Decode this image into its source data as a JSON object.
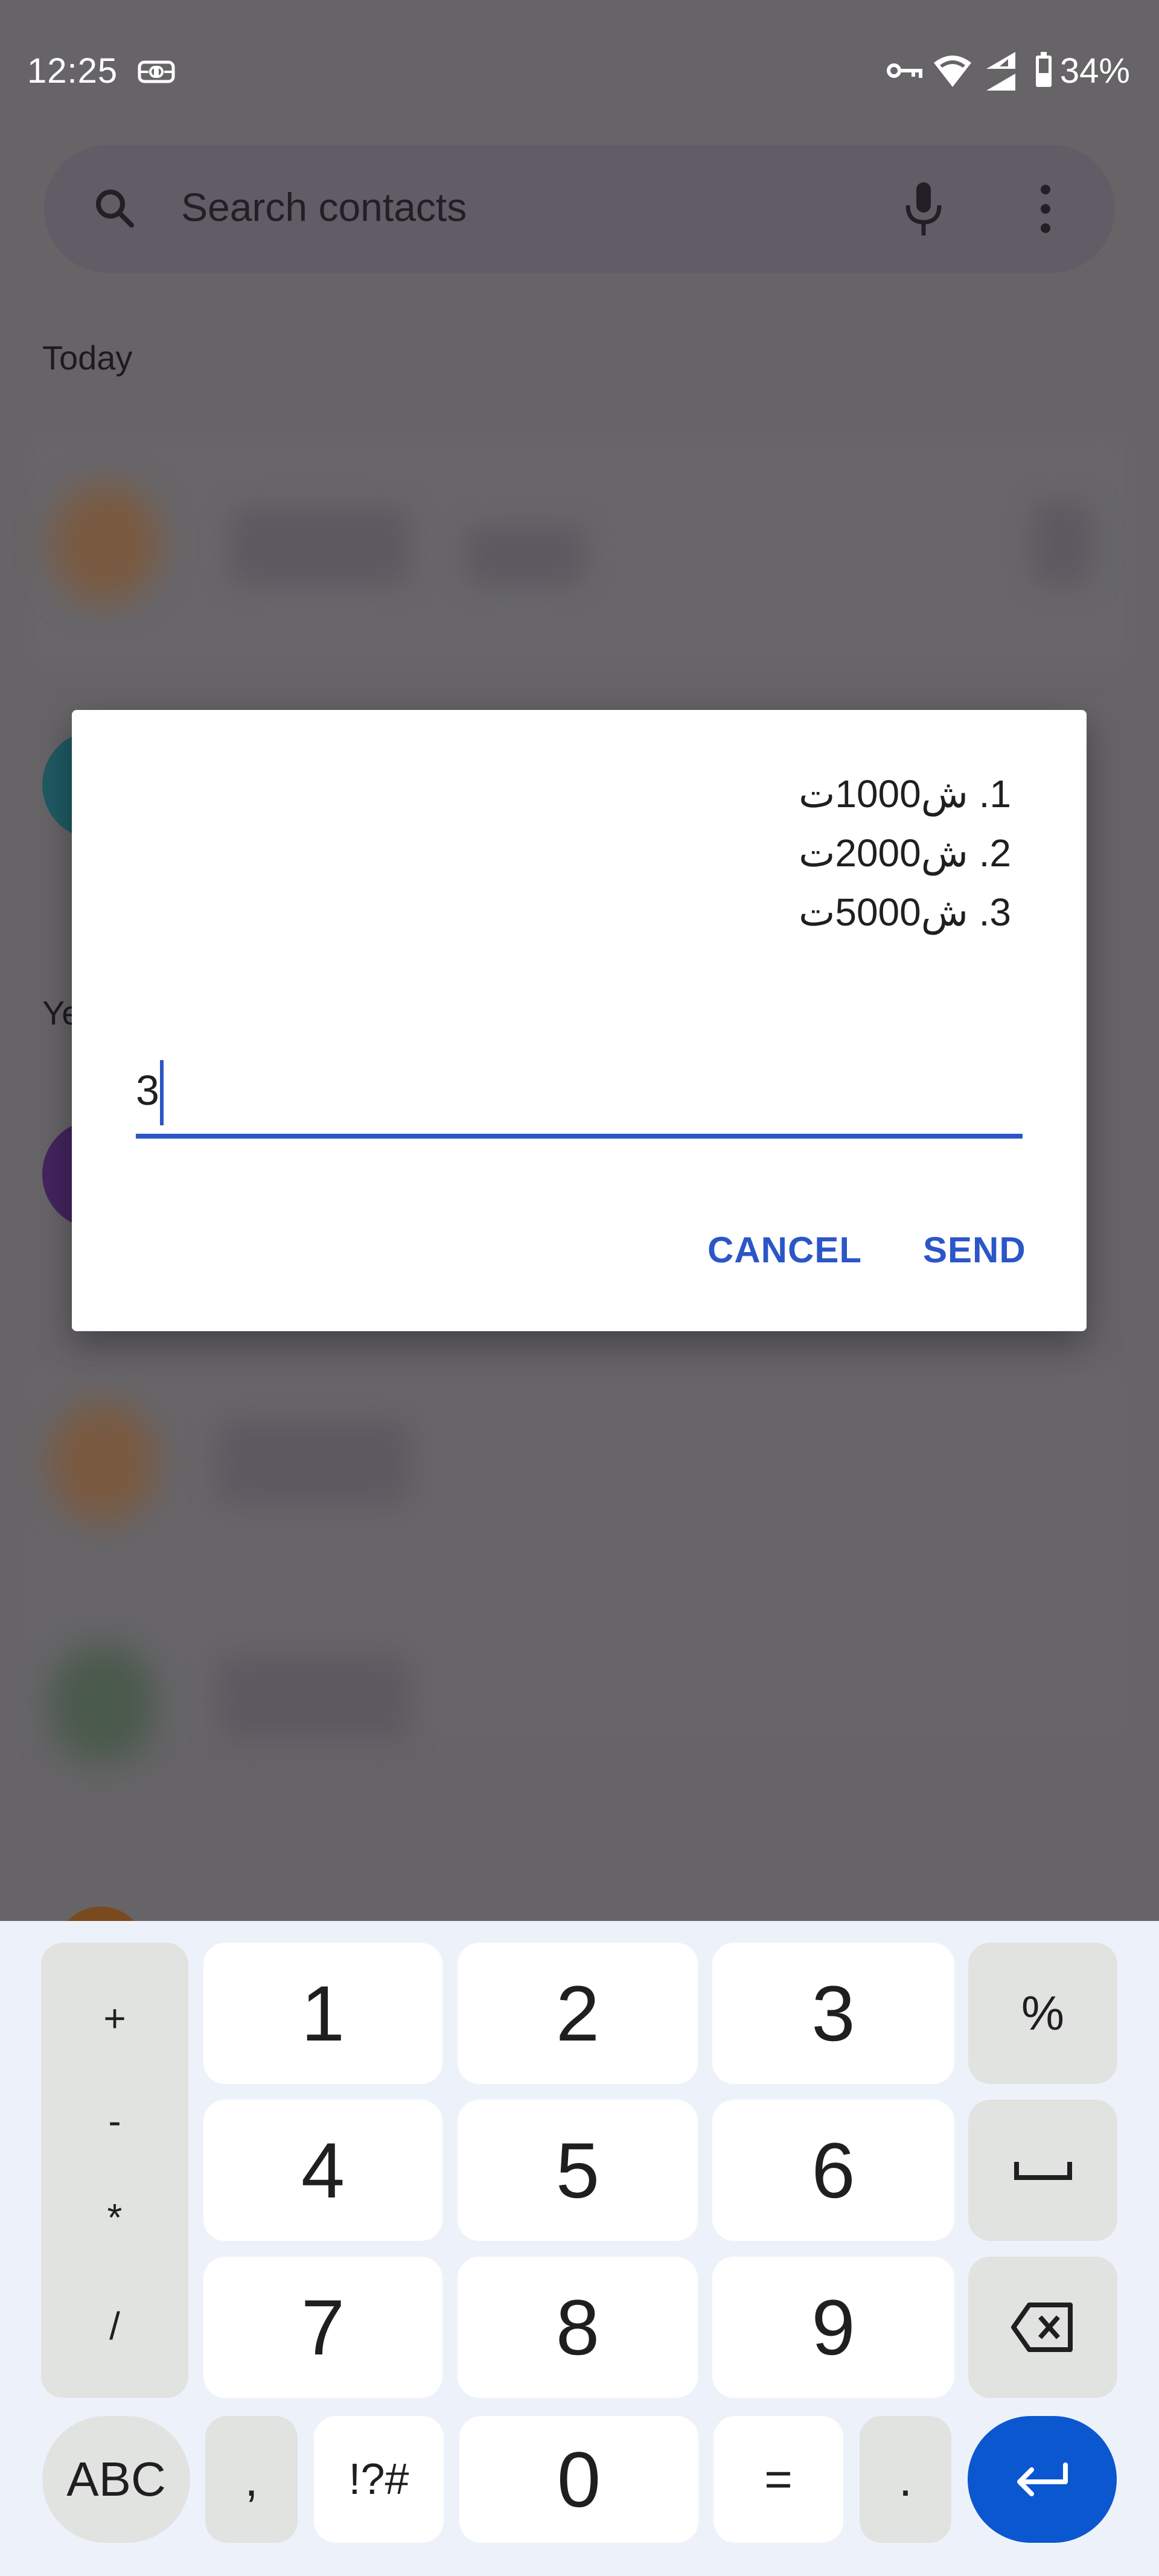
{
  "status_bar": {
    "time": "12:25",
    "left_icons": [
      "vpn-link-icon"
    ],
    "right_icons": [
      "vpn-key-icon",
      "wifi-icon",
      "cell-signal-icon",
      "battery-icon"
    ],
    "battery_percent": "34%"
  },
  "search": {
    "placeholder": "Search contacts",
    "icons": [
      "search-icon",
      "mic-icon",
      "more-vert-icon"
    ]
  },
  "sections": {
    "today": "Today",
    "yesterday_partial": "Ye"
  },
  "dialog": {
    "message_lines": [
      "1. ش1000ت",
      "2. ش2000ت",
      "3. ش5000ت"
    ],
    "input_value": "3",
    "cancel_label": "CANCEL",
    "send_label": "SEND",
    "accent_color": "#2b56c8"
  },
  "keyboard": {
    "left_symbols": [
      "+",
      "-",
      "*",
      "/"
    ],
    "rows": [
      [
        "1",
        "2",
        "3",
        "%"
      ],
      [
        "4",
        "5",
        "6",
        "space"
      ],
      [
        "7",
        "8",
        "9",
        "backspace"
      ]
    ],
    "bottom_row": [
      "ABC",
      ",",
      "!?#",
      "0",
      "=",
      ".",
      "enter"
    ],
    "space_glyph": "␣",
    "enter_color": "#0b57d0"
  }
}
